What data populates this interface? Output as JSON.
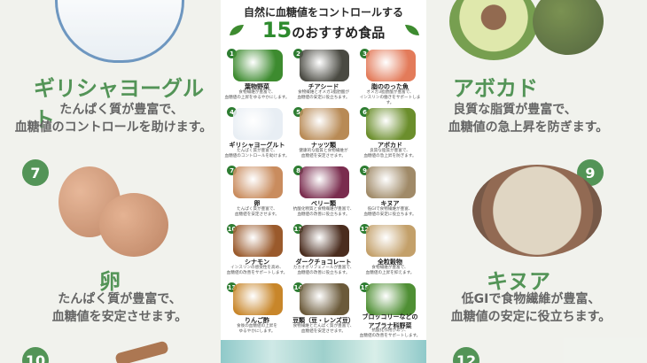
{
  "left_panel": {
    "title": "ギリシャヨーグルト",
    "desc_lines": [
      "たんぱく質が豊富で、",
      "血糖値のコントロールを助けます。"
    ],
    "num": "7",
    "title2": "卵",
    "desc2_lines": [
      "たんぱく質が豊富で、",
      "血糖値を安定させます。"
    ],
    "num_bottom": "10"
  },
  "right_panel": {
    "title": "アボカド",
    "desc_lines": [
      "良質な脂質が豊富で、",
      "血糖値の急上昇を防ぎます。"
    ],
    "num": "9",
    "title2": "キヌア",
    "desc2_lines": [
      "低GIで食物繊維が豊富、",
      "血糖値の安定に役立ちます。"
    ],
    "num_bottom": "12"
  },
  "header": {
    "line1": "自然に血糖値をコントロールする",
    "number": "15",
    "line2": "のおすすめ食品"
  },
  "items": [
    {
      "num": "1",
      "name": "葉物野菜",
      "d1": "食物繊維が豊富で、",
      "d2": "血糖値の上昇をゆるやかにします。",
      "color": "#3d8b2f"
    },
    {
      "num": "2",
      "name": "チアシード",
      "d1": "食物繊維とオメガ3脂肪酸が",
      "d2": "血糖値の安定に役立ちます。",
      "color": "#4a4a42"
    },
    {
      "num": "3",
      "name": "脂ののった魚",
      "d1": "オメガ3脂肪酸が豊富で、",
      "d2": "インスリンの働きをサポートします。",
      "color": "#e37b5a"
    },
    {
      "num": "4",
      "name": "ギリシャヨーグルト",
      "d1": "たんぱく質が豊富で、",
      "d2": "血糖値のコントロールを助けます。",
      "color": "#e8eef4"
    },
    {
      "num": "5",
      "name": "ナッツ類",
      "d1": "健康的な脂質と食物繊維が",
      "d2": "血糖値を安定させます。",
      "color": "#b88a55"
    },
    {
      "num": "6",
      "name": "アボカド",
      "d1": "良質な脂質が豊富で、",
      "d2": "血糖値の急上昇を防ぎます。",
      "color": "#6b8e2c"
    },
    {
      "num": "7",
      "name": "卵",
      "d1": "たんぱく質が豊富で、",
      "d2": "血糖値を安定させます。",
      "color": "#c98c5e"
    },
    {
      "num": "8",
      "name": "ベリー類",
      "d1": "抗酸化物質と食物繊維が豊富で、",
      "d2": "血糖値の改善に役立ちます。",
      "color": "#7a2c4e"
    },
    {
      "num": "9",
      "name": "キヌア",
      "d1": "低GIで食物繊維が豊富、",
      "d2": "血糖値の安定に役立ちます。",
      "color": "#a08a68"
    },
    {
      "num": "10",
      "name": "シナモン",
      "d1": "インスリンの感受性を高め、",
      "d2": "血糖値の改善をサポートします。",
      "color": "#9a5a2c"
    },
    {
      "num": "11",
      "name": "ダークチョコレート",
      "d1": "カカオポリフェノールが豊富で、",
      "d2": "血糖値の改善に役立ちます。",
      "color": "#4a2c1e"
    },
    {
      "num": "12",
      "name": "全粒穀物",
      "d1": "食物繊維が豊富で、",
      "d2": "血糖値の上昇を抑えます。",
      "color": "#c3a06a"
    },
    {
      "num": "13",
      "name": "りんご酢",
      "d1": "食後の血糖値の上昇を",
      "d2": "ゆるやかにします。",
      "color": "#c8862a"
    },
    {
      "num": "14",
      "name": "豆類（豆・レンズ豆）",
      "d1": "食物繊維とたんぱく質が豊富で、",
      "d2": "血糖値を安定させます。",
      "color": "#6b5a3a"
    },
    {
      "num": "15",
      "name": "ブロッコリーなどの",
      "name2": "アブラナ科野菜",
      "d1": "抗酸化作用があり、",
      "d2": "血糖値の改善をサポートします。",
      "color": "#4f8f34"
    }
  ],
  "colors": {
    "accent": "#2e7d32"
  }
}
